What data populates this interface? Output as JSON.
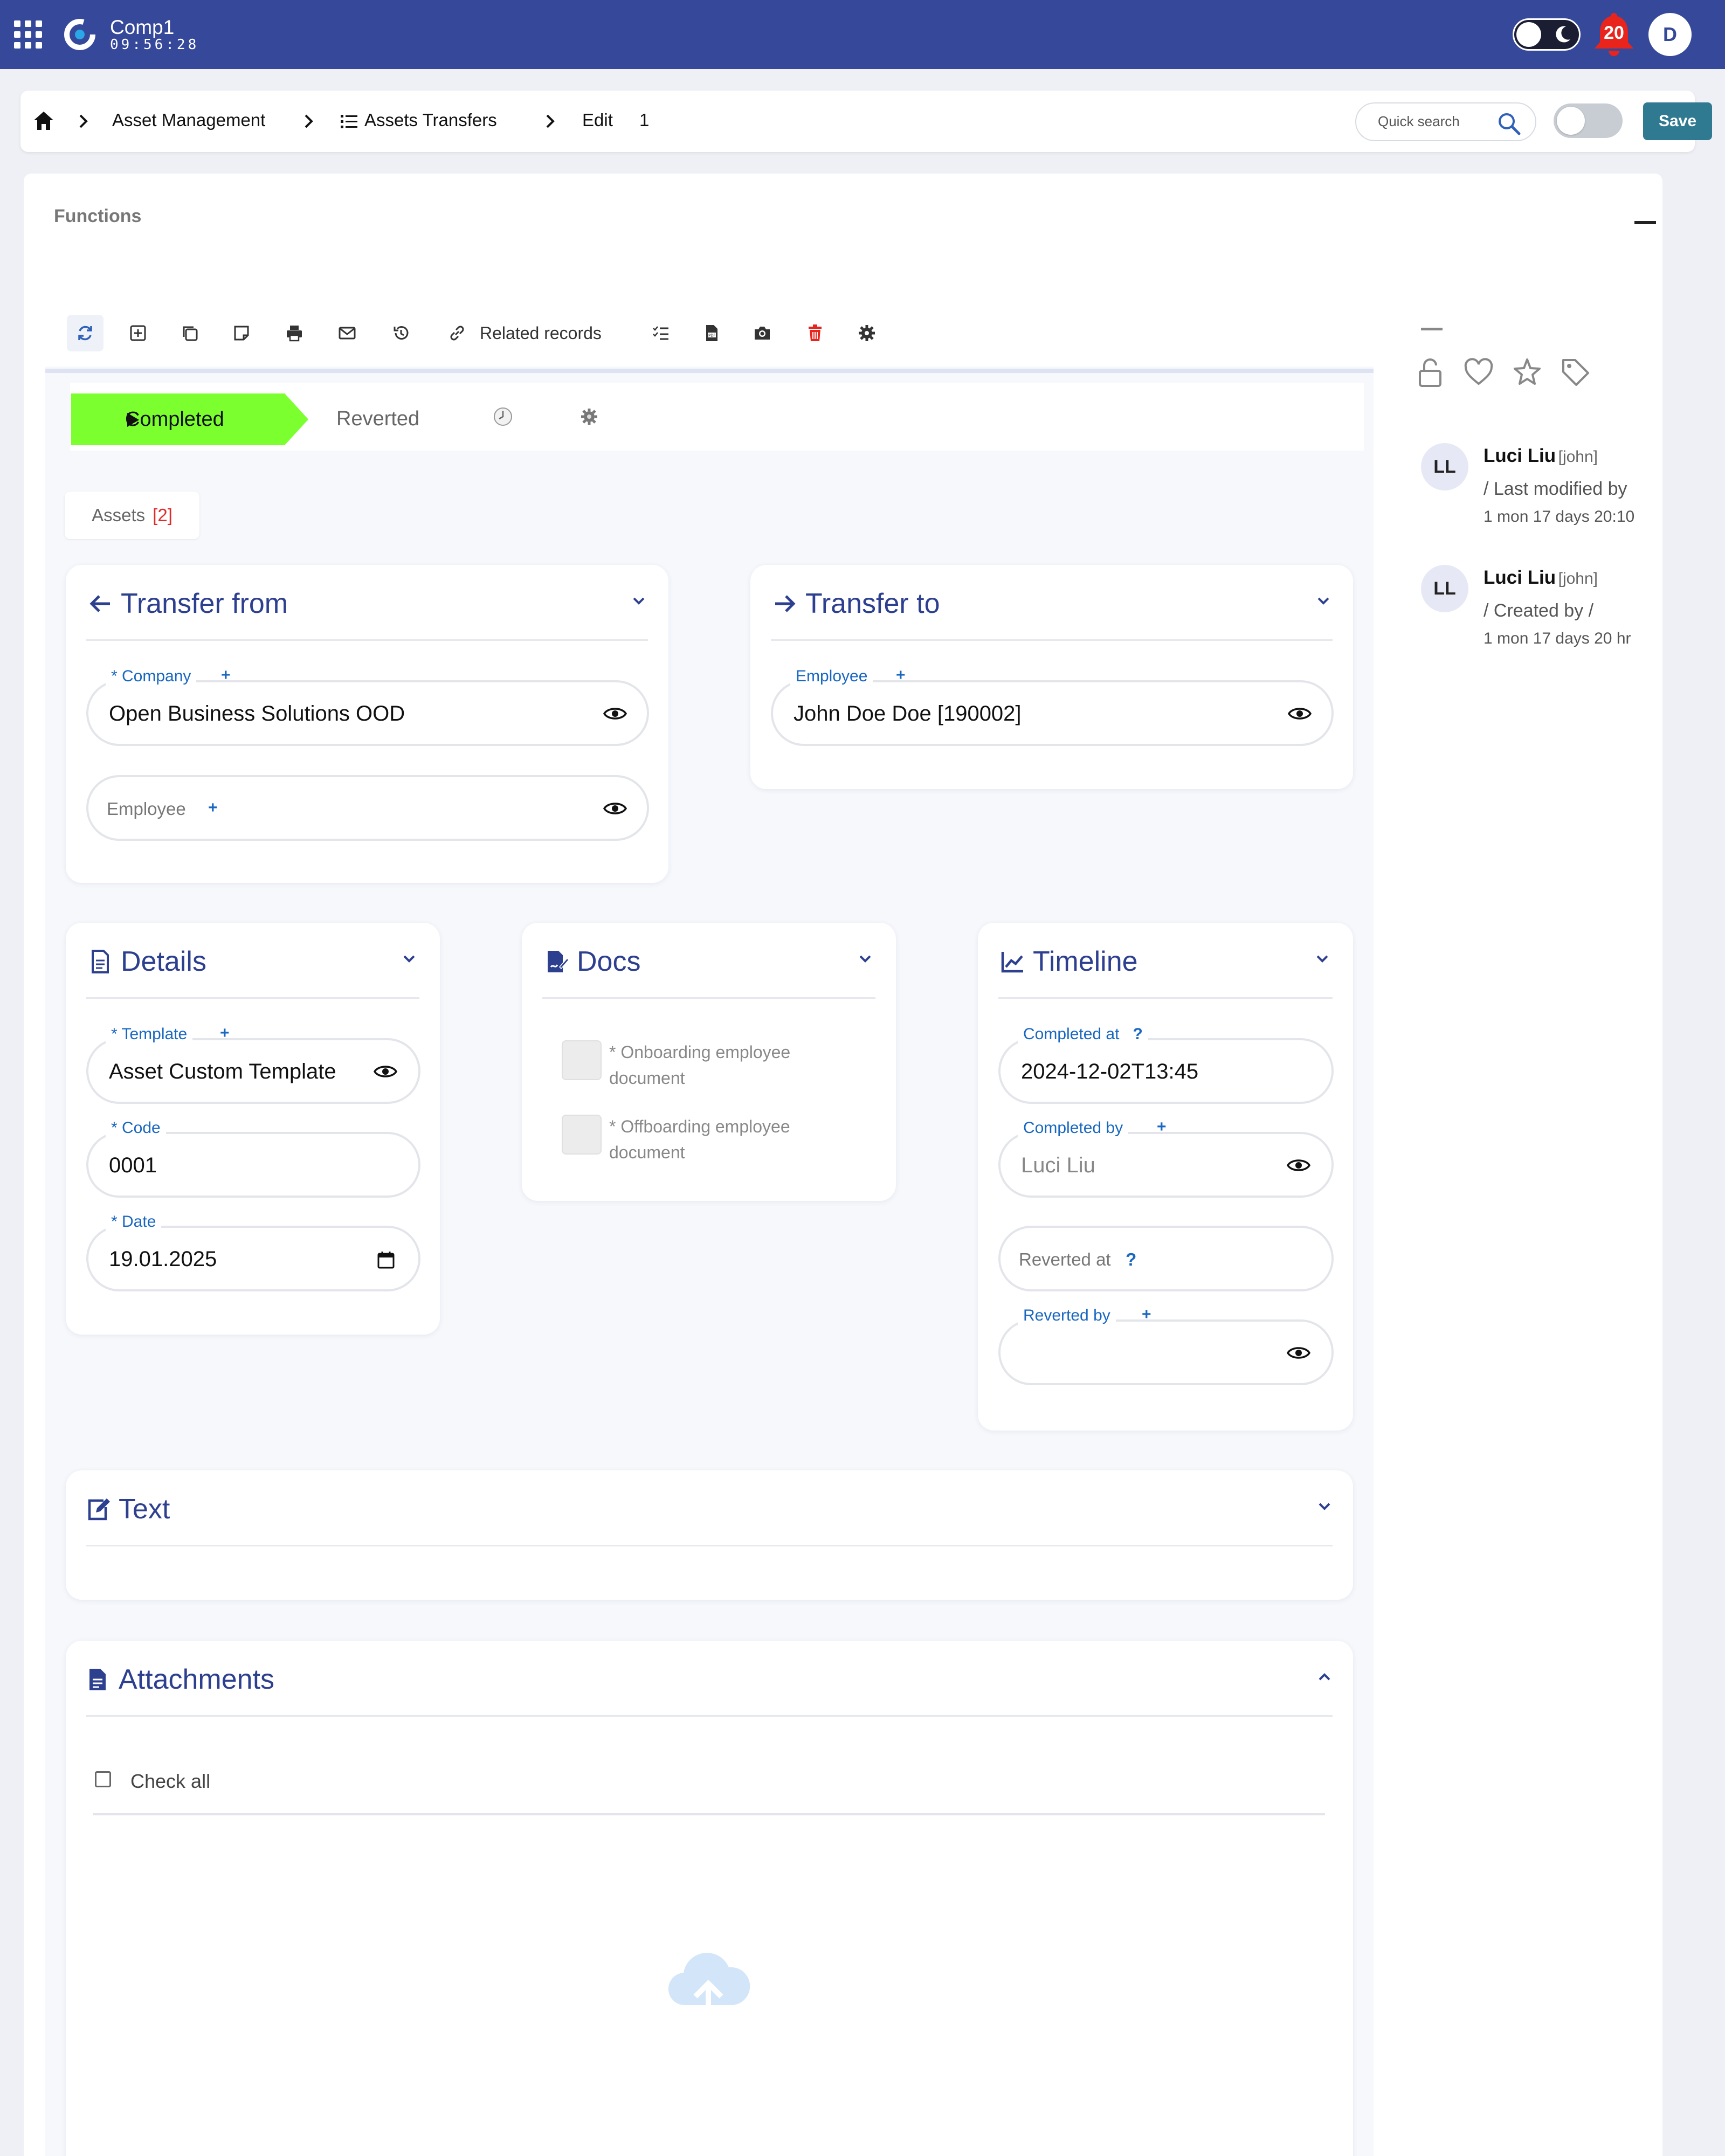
{
  "topbar": {
    "company": "Comp1",
    "clock": "09:56:28",
    "notification_count": "20",
    "user_initial": "D",
    "color": "#36489a"
  },
  "breadcrumb": {
    "items": [
      "Asset Management",
      "Assets Transfers",
      "Edit",
      "1"
    ],
    "search_placeholder": "Quick search",
    "save_label": "Save"
  },
  "functions": {
    "title": "Functions",
    "related_records": "Related records"
  },
  "status": {
    "completed": "Completed",
    "reverted": "Reverted",
    "active_color": "#7cff2f"
  },
  "assets_tab": {
    "label": "Assets",
    "count": "[2]"
  },
  "transfer_from": {
    "title": "Transfer from",
    "company_label": "* Company",
    "company_value": "Open Business Solutions OOD",
    "employee_label": "Employee"
  },
  "transfer_to": {
    "title": "Transfer to",
    "employee_label": "Employee",
    "employee_value": "John Doe Doe [190002]"
  },
  "details": {
    "title": "Details",
    "template_label": "* Template",
    "template_value": "Asset Custom Template",
    "code_label": "* Code",
    "code_value": "0001",
    "date_label": "* Date",
    "date_value": "19.01.2025"
  },
  "docs": {
    "title": "Docs",
    "onboarding": "* Onboarding employee document",
    "offboarding": "* Offboarding employee document"
  },
  "timeline": {
    "title": "Timeline",
    "completed_at_label": "Completed at",
    "completed_at_value": "2024-12-02T13:45",
    "completed_by_label": "Completed by",
    "completed_by_value": "Luci Liu",
    "reverted_at_label": "Reverted at",
    "reverted_by_label": "Reverted by",
    "help": "?"
  },
  "text_section": {
    "title": "Text"
  },
  "attachments": {
    "title": "Attachments",
    "check_all": "Check all"
  },
  "activity": [
    {
      "initials": "LL",
      "name": "Luci Liu",
      "user": "[john]",
      "action": "/ Last modified by",
      "time": "1 mon 17 days 20:10"
    },
    {
      "initials": "LL",
      "name": "Luci Liu",
      "user": "[john]",
      "action": "/ Created by /",
      "time": "1 mon 17 days 20 hr"
    }
  ],
  "plus": "+"
}
